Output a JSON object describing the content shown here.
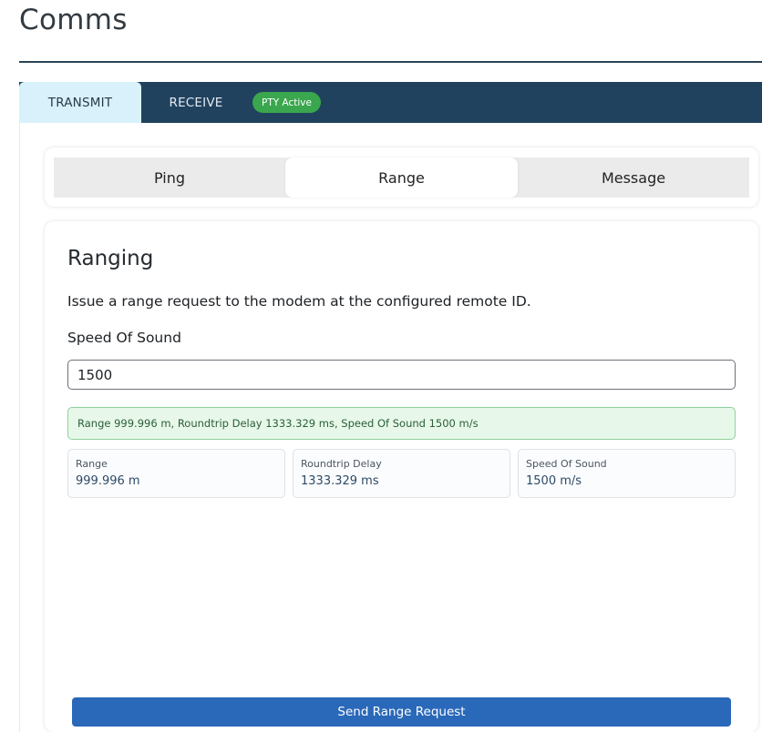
{
  "page": {
    "title": "Comms"
  },
  "tabs": {
    "transmit": "TRANSMIT",
    "receive": "RECEIVE",
    "status_badge": "PTY Active"
  },
  "segments": {
    "items": [
      {
        "label": "Ping"
      },
      {
        "label": "Range",
        "selected": true
      },
      {
        "label": "Message"
      }
    ]
  },
  "ranging": {
    "title": "Ranging",
    "description": "Issue a range request to the modem at the configured remote ID.",
    "speed_label": "Speed Of Sound",
    "speed_value": "1500",
    "result_message": "Range 999.996 m, Roundtrip Delay 1333.329 ms, Speed Of Sound 1500 m/s",
    "stats": [
      {
        "label": "Range",
        "value": "999.996 m"
      },
      {
        "label": "Roundtrip Delay",
        "value": "1333.329 ms"
      },
      {
        "label": "Speed Of Sound",
        "value": "1500 m/s"
      }
    ],
    "send_label": "Send Range Request"
  },
  "colors": {
    "tabbar": "#21425e",
    "active_tab": "#d8f1fb",
    "badge": "#3aa64e",
    "primary_button": "#2a68b9",
    "success_bg": "#e7f8ea"
  }
}
